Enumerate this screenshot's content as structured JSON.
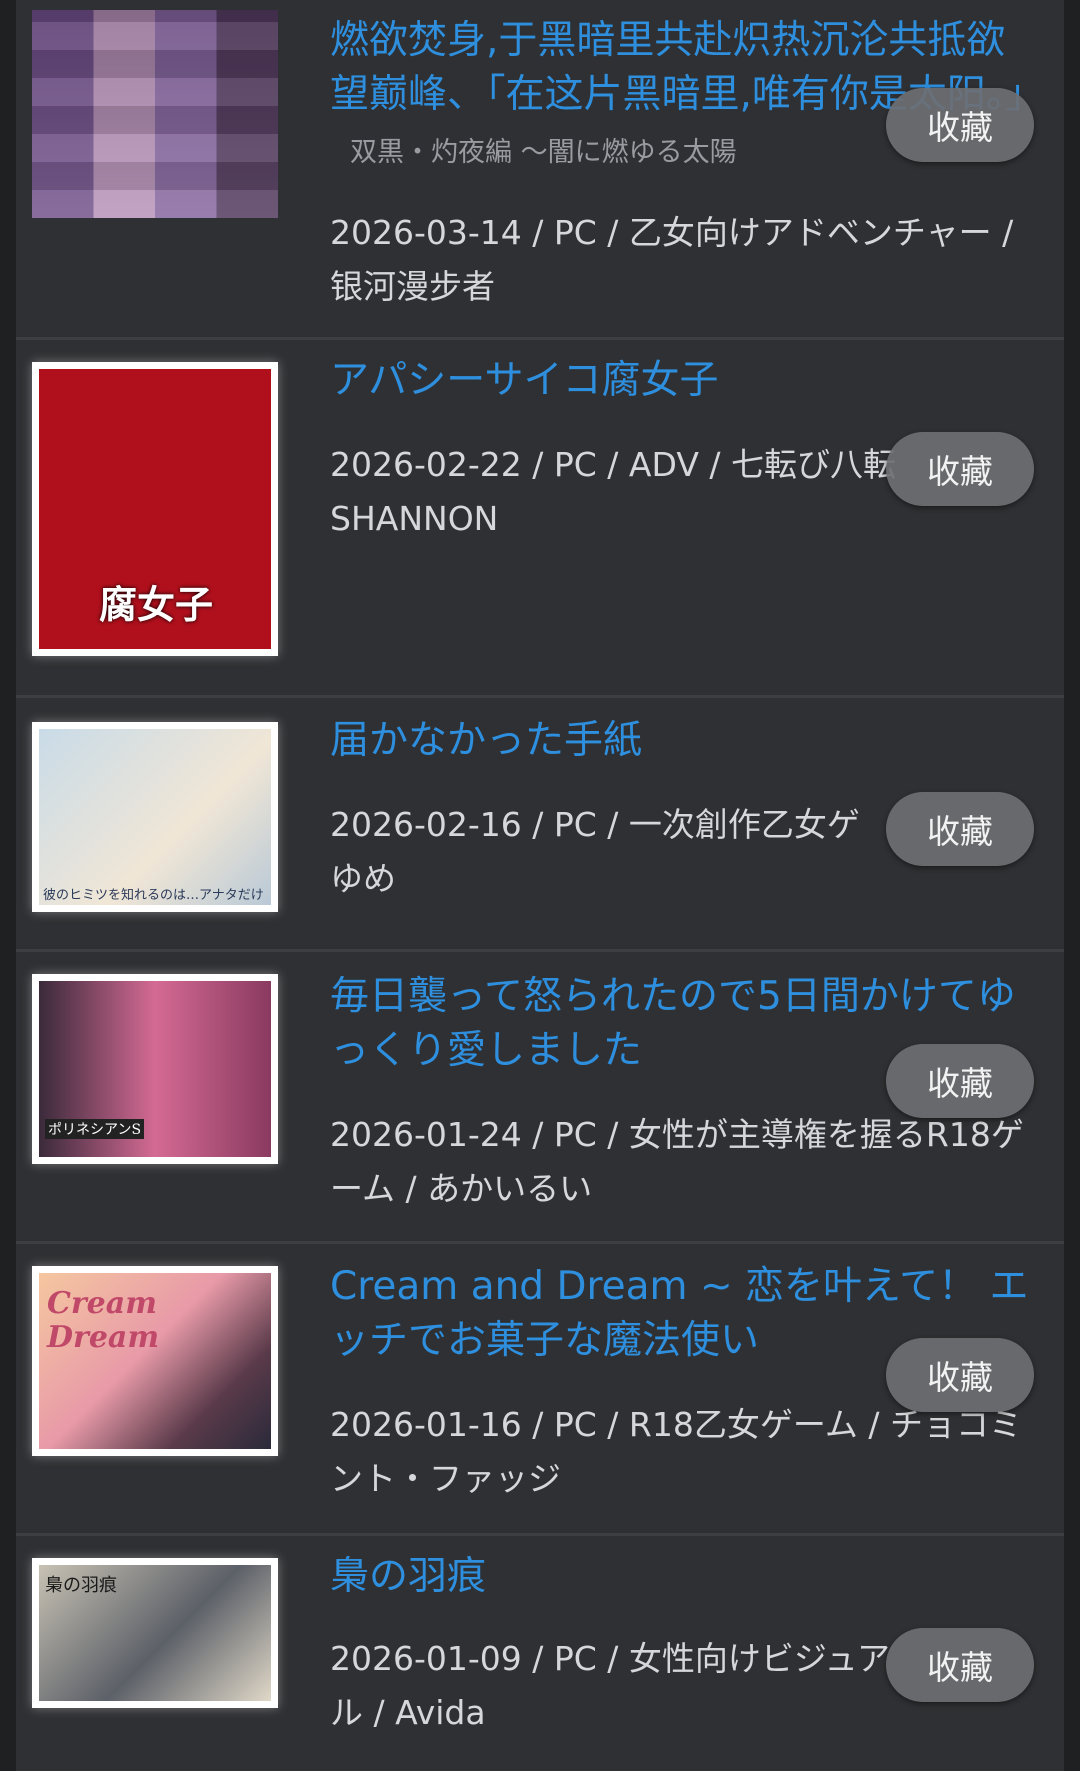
{
  "items": [
    {
      "title": "燃欲焚身,于黑暗里共赴炽热沉沦共抵欲望巅峰、「在这片黑暗里,唯有你是太阳。」",
      "subtitle": "双黒・灼夜編 ～闇に燃ゆる太陽",
      "meta": "2026-03-14 / PC / 乙女向けアドベンチャー / 银河漫步者",
      "button": "收藏",
      "thumb_icon": "cover-image-pixelated"
    },
    {
      "title": "アパシーサイコ腐女子",
      "subtitle": "",
      "meta": "2026-02-22 / PC / ADV / 七転び八転 SHANNON",
      "button": "收藏",
      "thumb_icon": "cover-image",
      "thumb_text": "腐女子"
    },
    {
      "title": "届かなかった手紙",
      "subtitle": "",
      "meta": "2026-02-16 / PC / 一次創作乙女ゲ ゆめ",
      "button": "收藏",
      "thumb_icon": "cover-image",
      "thumb_text": "彼のヒミツを知れるのは…アナタだけ"
    },
    {
      "title": "毎日襲って怒られたので5日間かけてゆっくり愛しました",
      "subtitle": "",
      "meta": "2026-01-24 / PC / 女性が主導権を握るR18ゲーム / あかいるい",
      "button": "收藏",
      "thumb_icon": "cover-image-pixelated",
      "thumb_text": "ポリネシアンS"
    },
    {
      "title": "Cream and Dream ~ 恋を叶えて！ エッチでお菓子な魔法使い",
      "subtitle": "",
      "meta": "2026-01-16 / PC / R18乙女ゲーム / チョコミント・ファッジ",
      "button": "收藏",
      "thumb_icon": "cover-image",
      "thumb_text": "Cream Dream"
    },
    {
      "title": "梟の羽痕",
      "subtitle": "",
      "meta": "2026-01-09 / PC / 女性向けビジュアル / Avida",
      "button": "收藏",
      "thumb_icon": "cover-image",
      "thumb_text": "梟の羽痕"
    }
  ]
}
